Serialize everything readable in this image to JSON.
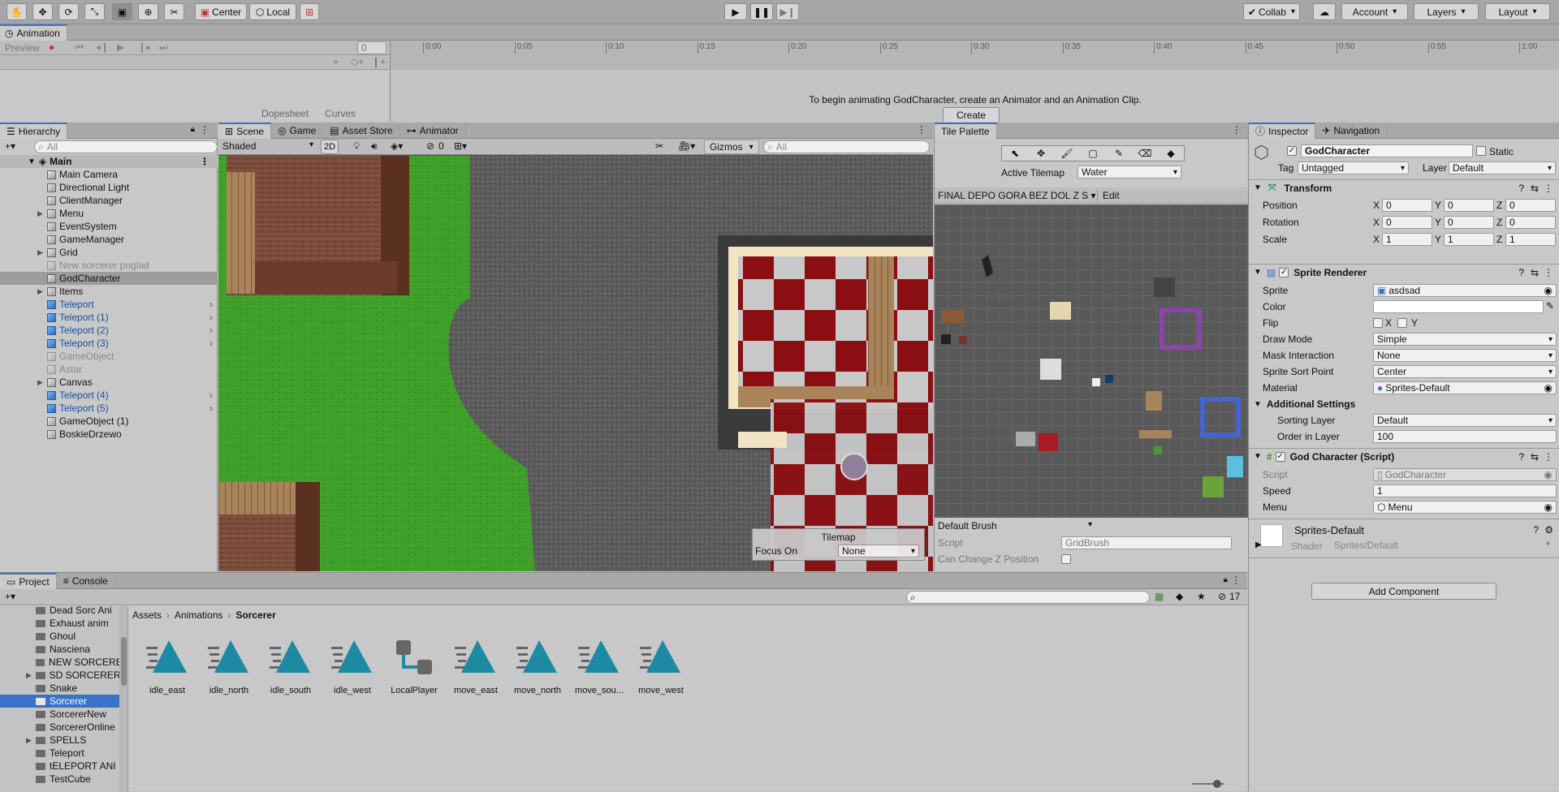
{
  "toolbar": {
    "tools": [
      "hand-tool",
      "move-tool",
      "rotate-tool",
      "scale-tool",
      "rect-tool",
      "transform-tool",
      "custom-tool"
    ],
    "pivot_label": "Center",
    "space_label": "Local",
    "collab_label": "Collab",
    "account_label": "Account",
    "layers_label": "Layers",
    "layout_label": "Layout"
  },
  "animation": {
    "title": "Animation",
    "preview_label": "Preview",
    "frame_value": "0",
    "ticks": [
      "0:00",
      "0:05",
      "0:10",
      "0:15",
      "0:20",
      "0:25",
      "0:30",
      "0:35",
      "0:40",
      "0:45",
      "0:50",
      "0:55",
      "1:00"
    ],
    "message": "To begin animating GodCharacter, create an Animator and an Animation Clip.",
    "create_label": "Create",
    "dopesheet_label": "Dopesheet",
    "curves_label": "Curves"
  },
  "hierarchy": {
    "tab_label": "Hierarchy",
    "search_placeholder": "All",
    "scene_name": "Main",
    "items": [
      {
        "label": "Main Camera",
        "kind": "normal"
      },
      {
        "label": "Directional Light",
        "kind": "normal"
      },
      {
        "label": "ClientManager",
        "kind": "normal"
      },
      {
        "label": "Menu",
        "kind": "normal",
        "expand": true
      },
      {
        "label": "EventSystem",
        "kind": "normal"
      },
      {
        "label": "GameManager",
        "kind": "normal"
      },
      {
        "label": "Grid",
        "kind": "normal",
        "expand": true
      },
      {
        "label": "New sorcerer poglad",
        "kind": "disabled"
      },
      {
        "label": "GodCharacter",
        "kind": "selected"
      },
      {
        "label": "Items",
        "kind": "normal",
        "expand": true
      },
      {
        "label": "Teleport",
        "kind": "prefab"
      },
      {
        "label": "Teleport (1)",
        "kind": "prefab"
      },
      {
        "label": "Teleport (2)",
        "kind": "prefab"
      },
      {
        "label": "Teleport (3)",
        "kind": "prefab"
      },
      {
        "label": "GameObject",
        "kind": "disabled"
      },
      {
        "label": "Astar",
        "kind": "disabled"
      },
      {
        "label": "Canvas",
        "kind": "normal",
        "expand": true
      },
      {
        "label": "Teleport (4)",
        "kind": "prefab"
      },
      {
        "label": "Teleport (5)",
        "kind": "prefab"
      },
      {
        "label": "GameObject (1)",
        "kind": "normal"
      },
      {
        "label": "BoskieDrzewo",
        "kind": "normal"
      }
    ]
  },
  "scene": {
    "tabs": [
      "Scene",
      "Game",
      "Asset Store",
      "Animator"
    ],
    "shading": "Shaded",
    "mode_2d": "2D",
    "hidden_count": "0",
    "gizmos_label": "Gizmos",
    "search_placeholder": "All",
    "tilemap_overlay": {
      "title": "Tilemap",
      "focus_label": "Focus On",
      "focus_value": "None"
    }
  },
  "palette": {
    "tab_label": "Tile Palette",
    "active_tilemap_label": "Active Tilemap",
    "active_tilemap_value": "Water",
    "palette_name": "FINAL DEPO GORA BEZ DOL Z S",
    "edit_label": "Edit",
    "brush_label": "Default Brush",
    "script_label": "Script",
    "script_value": "GridBrush",
    "change_z_label": "Can Change Z Position"
  },
  "inspector": {
    "tabs": [
      "Inspector",
      "Navigation"
    ],
    "object_name": "GodCharacter",
    "static_label": "Static",
    "tag_label": "Tag",
    "tag_value": "Untagged",
    "layer_label": "Layer",
    "layer_value": "Default",
    "transform": {
      "title": "Transform",
      "position_label": "Position",
      "position": [
        "0",
        "0",
        "0"
      ],
      "rotation_label": "Rotation",
      "rotation": [
        "0",
        "0",
        "0"
      ],
      "scale_label": "Scale",
      "scale": [
        "1",
        "1",
        "1"
      ]
    },
    "sprite_renderer": {
      "title": "Sprite Renderer",
      "sprite_label": "Sprite",
      "sprite_value": "asdsad",
      "color_label": "Color",
      "flip_label": "Flip",
      "flip_x": "X",
      "flip_y": "Y",
      "draw_mode_label": "Draw Mode",
      "draw_mode_value": "Simple",
      "mask_label": "Mask Interaction",
      "mask_value": "None",
      "sort_point_label": "Sprite Sort Point",
      "sort_point_value": "Center",
      "material_label": "Material",
      "material_value": "Sprites-Default",
      "additional_label": "Additional Settings",
      "sorting_layer_label": "Sorting Layer",
      "sorting_layer_value": "Default",
      "order_label": "Order in Layer",
      "order_value": "100"
    },
    "god_script": {
      "title": "God Character (Script)",
      "script_label": "Script",
      "script_value": "GodCharacter",
      "speed_label": "Speed",
      "speed_value": "1",
      "menu_label": "Menu",
      "menu_value": "Menu"
    },
    "material": {
      "name": "Sprites-Default",
      "shader_label": "Shader",
      "shader_value": "Sprites/Default"
    },
    "add_component_label": "Add Component",
    "axis_x": "X",
    "axis_y": "Y",
    "axis_z": "Z"
  },
  "project": {
    "tabs": [
      "Project",
      "Console"
    ],
    "badge_count": "17",
    "breadcrumb": [
      "Assets",
      "Animations",
      "Sorcerer"
    ],
    "folders": [
      {
        "label": "Dead Sorc Ani",
        "expand": false
      },
      {
        "label": "Exhaust anim",
        "expand": false
      },
      {
        "label": "Ghoul",
        "expand": false
      },
      {
        "label": "Nasciena",
        "expand": false
      },
      {
        "label": "NEW SORCERE",
        "expand": false
      },
      {
        "label": "SD SORCERER",
        "expand": true
      },
      {
        "label": "Snake",
        "expand": false
      },
      {
        "label": "Sorcerer",
        "expand": false,
        "selected": true
      },
      {
        "label": "SorcererNew",
        "expand": false
      },
      {
        "label": "SorcererOnline",
        "expand": false
      },
      {
        "label": "SPELLS",
        "expand": true
      },
      {
        "label": "Teleport",
        "expand": false
      },
      {
        "label": "tELEPORT ANI",
        "expand": false
      },
      {
        "label": "TestCube",
        "expand": false
      }
    ],
    "assets": [
      {
        "label": "idle_east",
        "kind": "clip"
      },
      {
        "label": "idle_north",
        "kind": "clip"
      },
      {
        "label": "idle_south",
        "kind": "clip"
      },
      {
        "label": "idle_west",
        "kind": "clip"
      },
      {
        "label": "LocalPlayer",
        "kind": "controller"
      },
      {
        "label": "move_east",
        "kind": "clip"
      },
      {
        "label": "move_north",
        "kind": "clip"
      },
      {
        "label": "move_sou...",
        "kind": "clip"
      },
      {
        "label": "move_west",
        "kind": "clip"
      }
    ]
  }
}
